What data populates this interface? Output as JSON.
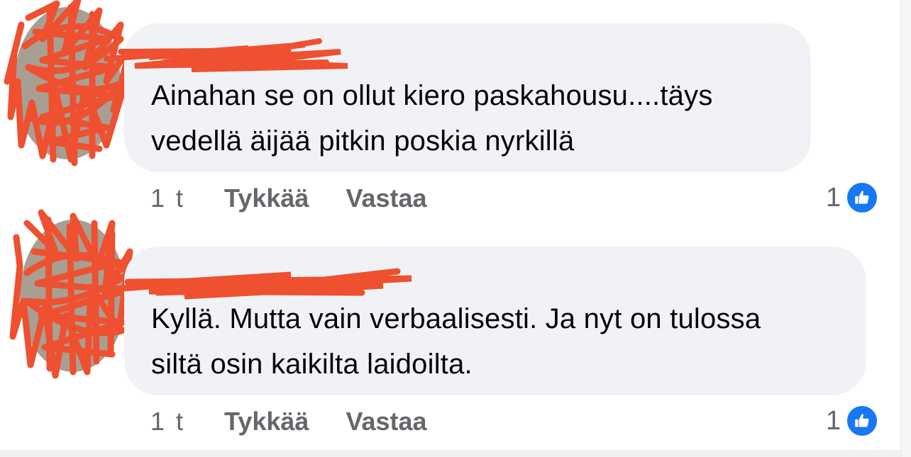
{
  "comments": [
    {
      "author": "",
      "text_line1": "Ainahan se on ollut kiero paskahousu....täys",
      "text_line2": "vedellä äijää pitkin poskia nyrkillä",
      "time": "1 t",
      "like_label": "Tykkää",
      "reply_label": "Vastaa",
      "reaction_count": "1",
      "reaction_icon": "like-thumbs-up-icon"
    },
    {
      "author": "",
      "text_line1": "Kyllä. Mutta vain verbaalisesti. Ja nyt on tulossa",
      "text_line2": "siltä osin kaikilta laidoilta.",
      "time": "1 t",
      "like_label": "Tykkää",
      "reply_label": "Vastaa",
      "reaction_count": "1",
      "reaction_icon": "like-thumbs-up-icon"
    }
  ],
  "colors": {
    "bubble": "#f0f2f5",
    "text": "#050505",
    "secondary_text": "#65676b",
    "like_blue": "#1877f2",
    "redaction": "#ee5030"
  }
}
